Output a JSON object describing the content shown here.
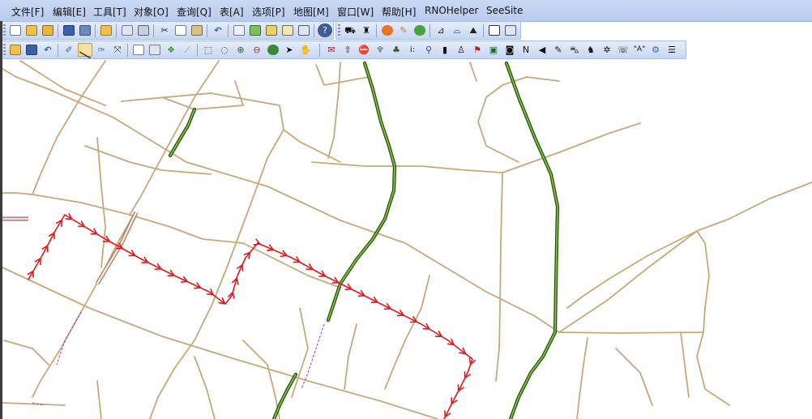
{
  "menu": [
    {
      "name": "menu-file",
      "label": "文件[F]"
    },
    {
      "name": "menu-edit",
      "label": "编辑[E]"
    },
    {
      "name": "menu-tools",
      "label": "工具[T]"
    },
    {
      "name": "menu-object",
      "label": "对象[O]"
    },
    {
      "name": "menu-query",
      "label": "查询[Q]"
    },
    {
      "name": "menu-table",
      "label": "表[A]"
    },
    {
      "name": "menu-options",
      "label": "选项[P]"
    },
    {
      "name": "menu-map",
      "label": "地图[M]"
    },
    {
      "name": "menu-window",
      "label": "窗口[W]"
    },
    {
      "name": "menu-help",
      "label": "帮助[H]"
    },
    {
      "name": "menu-rnohelper",
      "label": "RNOHelper"
    },
    {
      "name": "menu-seesite",
      "label": "SeeSite"
    }
  ],
  "toolbar_text": {
    "north_label": "N",
    "text_tool_label": "i:",
    "style_label": "\"A\""
  },
  "colors": {
    "road": "#c8a878",
    "highway_dark": "#24520f",
    "highway_light": "#8cc63f",
    "route": "#e0181b",
    "accent_pink": "#b02bb0"
  },
  "map": {
    "drive_route_present": true
  }
}
